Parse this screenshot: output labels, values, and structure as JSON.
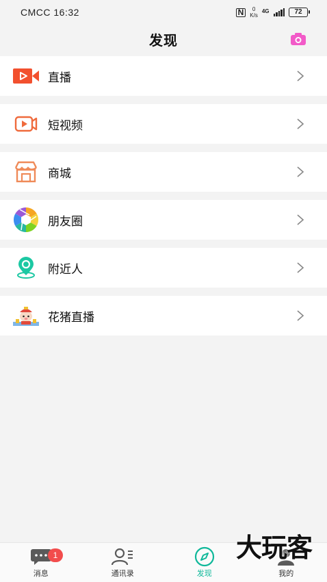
{
  "status_bar": {
    "carrier": "CMCC",
    "time": "16:32",
    "net_speed_value": "0",
    "net_speed_unit": "K/s",
    "network": "4G",
    "battery": "72"
  },
  "header": {
    "title": "发现",
    "camera_icon": "camera-icon"
  },
  "menu": {
    "items": [
      {
        "label": "直播",
        "icon": "live-video-icon",
        "color": "#f2502e"
      },
      {
        "label": "短视频",
        "icon": "short-video-icon",
        "color": "#ef6a3c"
      },
      {
        "label": "商城",
        "icon": "shop-icon",
        "color": "#ef8a58"
      },
      {
        "label": "朋友圈",
        "icon": "moments-aperture-icon",
        "color": "#3fb5e8"
      },
      {
        "label": "附近人",
        "icon": "location-pin-icon",
        "color": "#1cc8a3"
      },
      {
        "label": "花猪直播",
        "icon": "huazhu-mascot-icon",
        "color": "#e14a3c"
      }
    ]
  },
  "tabbar": {
    "tabs": [
      {
        "label": "消息",
        "icon": "chat-bubble-icon",
        "badge": "1"
      },
      {
        "label": "通讯录",
        "icon": "contacts-icon"
      },
      {
        "label": "发现",
        "icon": "compass-icon",
        "active": true
      },
      {
        "label": "我的",
        "icon": "profile-icon"
      }
    ]
  },
  "watermark": "大玩客",
  "colors": {
    "accent": "#0fb89a",
    "badge": "#f24c4c",
    "camera": "#f25ac8"
  }
}
